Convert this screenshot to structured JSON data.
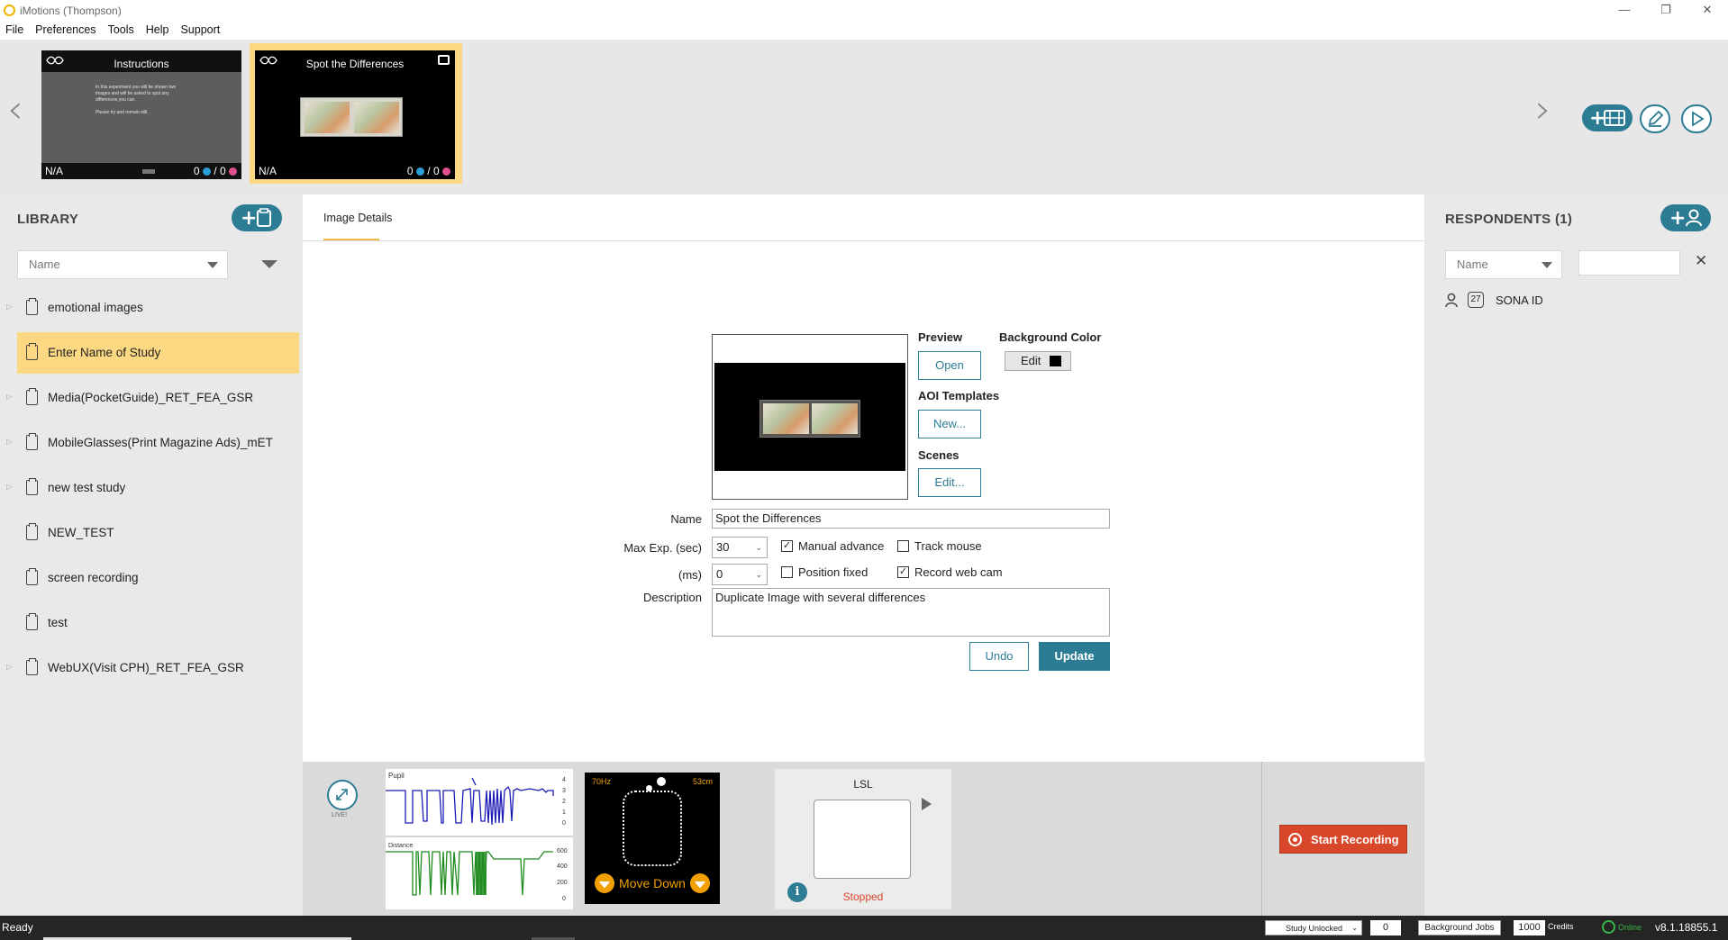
{
  "window": {
    "title": "iMotions (Thompson)",
    "controls": [
      "—",
      "❐",
      "✕"
    ]
  },
  "menu": [
    "File",
    "Preferences",
    "Tools",
    "Help",
    "Support"
  ],
  "strip": {
    "thumbs": [
      {
        "title": "Instructions",
        "na": "N/A",
        "count_a": "0",
        "count_b": "0",
        "text_lines": [
          "In this experiment you will be shown two",
          "images and will be asked to spot any",
          "differences you can.",
          "",
          "Please try and remain still."
        ]
      },
      {
        "title": "Spot the Differences",
        "na": "N/A",
        "count_a": "0",
        "count_b": "0"
      }
    ],
    "prev": "‹",
    "next": "›",
    "actions": [
      "add-stimulus",
      "edit",
      "play"
    ]
  },
  "library": {
    "title": "LIBRARY",
    "sort": "Name",
    "items": [
      {
        "label": "emotional images",
        "expandable": true
      },
      {
        "label": "Enter Name of Study",
        "expandable": false,
        "selected": true
      },
      {
        "label": "Media(PocketGuide)_RET_FEA_GSR",
        "expandable": true
      },
      {
        "label": "MobileGlasses(Print Magazine Ads)_mET",
        "expandable": true
      },
      {
        "label": "new test study",
        "expandable": true
      },
      {
        "label": "NEW_TEST",
        "expandable": false
      },
      {
        "label": "screen recording",
        "expandable": false
      },
      {
        "label": "test",
        "expandable": false
      },
      {
        "label": "WebUX(Visit CPH)_RET_FEA_GSR",
        "expandable": true
      }
    ]
  },
  "details": {
    "tab": "Image Details",
    "preview_label": "Preview",
    "open_btn": "Open",
    "bg_color_label": "Background Color",
    "bg_edit_btn": "Edit",
    "bg_color": "#000000",
    "aoi_label": "AOI Templates",
    "aoi_btn": "New...",
    "scenes_label": "Scenes",
    "scenes_btn": "Edit...",
    "name_label": "Name",
    "name_value": "Spot the Differences",
    "maxexp_label": "Max Exp. (sec)",
    "maxexp_value": "30",
    "ms_label": "(ms)",
    "ms_value": "0",
    "manual_advance": "Manual advance",
    "track_mouse": "Track mouse",
    "position_fixed": "Position fixed",
    "record_webcam": "Record web cam",
    "description_label": "Description",
    "description_value": "Duplicate Image with several differences",
    "undo_btn": "Undo",
    "update_btn": "Update"
  },
  "sensors": {
    "live": "LIVE!",
    "pupil_label": "Pupil",
    "pupil_ticks": [
      "4",
      "3",
      "2",
      "1",
      "0"
    ],
    "distance_label": "Distance",
    "distance_ticks": [
      "600",
      "400",
      "200",
      "0"
    ],
    "hz": "70Hz",
    "cm": "53cm",
    "move_down": "Move Down",
    "lsl_title": "LSL",
    "lsl_status": "Stopped",
    "start_recording": "Start Recording"
  },
  "respondents": {
    "title": "RESPONDENTS (1)",
    "sort": "Name",
    "items": [
      {
        "badge": "27",
        "label": "SONA ID"
      }
    ]
  },
  "status": {
    "ready": "Ready",
    "study_lock": "Study Unlocked",
    "jobs_count": "0",
    "background_jobs": "Background Jobs",
    "credits_value": "1000",
    "credits_label": "Credits",
    "online": "Online",
    "version": "v8.1.18855.1"
  },
  "colors": {
    "accent": "#2c7c93",
    "highlight": "#fdd882",
    "record": "#d9472b"
  }
}
